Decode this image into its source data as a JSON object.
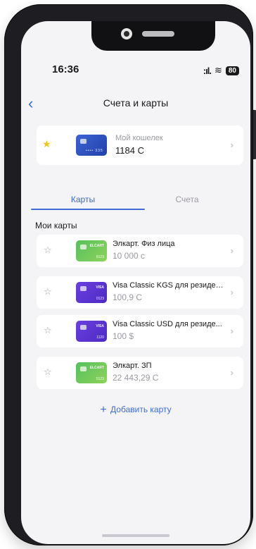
{
  "status_bar": {
    "time": "16:36",
    "signal": ":ıl.",
    "wifi": "≋",
    "battery": "80"
  },
  "nav": {
    "back_icon": "‹",
    "title": "Счета и карты"
  },
  "wallet": {
    "label": "Мой кошелек",
    "amount": "1184 С",
    "card_dots": "•••• 335"
  },
  "tabs": [
    {
      "label": "Карты",
      "active": true
    },
    {
      "label": "Счета",
      "active": false
    }
  ],
  "section_title": "Мои карты",
  "cards": [
    {
      "name": "Элкарт. Физ лица",
      "balance": "10 000 с",
      "color": "green",
      "brand": "ELCART",
      "num": "8123"
    },
    {
      "name": "Visa Classic KGS для резиден...",
      "balance": "100,9 С",
      "color": "purple",
      "brand": "VISA",
      "num": "0123"
    },
    {
      "name": "Visa Classic USD для резиде...",
      "balance": "100 $",
      "color": "purple",
      "brand": "VISA",
      "num": "1120"
    },
    {
      "name": "Элкарт. ЗП",
      "balance": "22 443,29 С",
      "color": "green",
      "brand": "ELCART",
      "num": "5123"
    }
  ],
  "add_card": {
    "plus": "+",
    "label": "Добавить карту"
  },
  "colors": {
    "accent": "#3f6bd3",
    "star_active": "#f0c419",
    "card_green": "#55c15d",
    "card_purple": "#6a3fe0",
    "card_blue": "#3b63d6"
  }
}
